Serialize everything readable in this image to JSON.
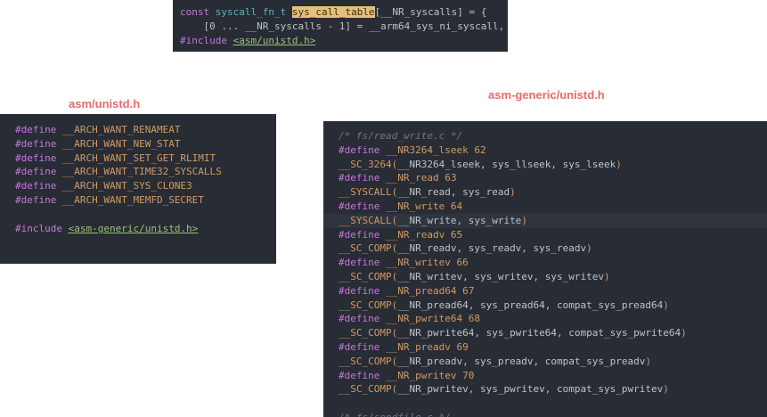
{
  "top_panel": {
    "lines": [
      [
        {
          "c": "kw",
          "t": "const "
        },
        {
          "c": "ty",
          "t": "syscall_fn_t "
        },
        {
          "c": "hl",
          "t": "sys_call_table"
        },
        {
          "c": "id",
          "t": "[__NR_syscalls] = {"
        }
      ],
      [
        {
          "c": "id",
          "t": "    [0 ... __NR_syscalls - 1] = __arm64_sys_ni_syscall,"
        }
      ],
      [
        {
          "c": "kw",
          "t": "#include "
        },
        {
          "c": "str",
          "t": "<asm/unistd.h>"
        }
      ]
    ]
  },
  "left_heading": "asm/unistd.h",
  "left_panel": {
    "lines": [
      [
        {
          "c": "kw",
          "t": "#define "
        },
        {
          "c": "mac",
          "t": "__ARCH_WANT_RENAMEAT"
        }
      ],
      [
        {
          "c": "kw",
          "t": "#define "
        },
        {
          "c": "mac",
          "t": "__ARCH_WANT_NEW_STAT"
        }
      ],
      [
        {
          "c": "kw",
          "t": "#define "
        },
        {
          "c": "mac",
          "t": "__ARCH_WANT_SET_GET_RLIMIT"
        }
      ],
      [
        {
          "c": "kw",
          "t": "#define "
        },
        {
          "c": "mac",
          "t": "__ARCH_WANT_TIME32_SYSCALLS"
        }
      ],
      [
        {
          "c": "kw",
          "t": "#define "
        },
        {
          "c": "mac",
          "t": "__ARCH_WANT_SYS_CLONE3"
        }
      ],
      [
        {
          "c": "kw",
          "t": "#define "
        },
        {
          "c": "mac",
          "t": "__ARCH_WANT_MEMFD_SECRET"
        }
      ],
      [],
      [
        {
          "c": "kw",
          "t": "#include "
        },
        {
          "c": "str",
          "t": "<asm-generic/unistd.h>"
        }
      ]
    ]
  },
  "right_heading": "asm-generic/unistd.h",
  "right_panel": {
    "lines": [
      [
        {
          "c": "cm",
          "t": "/* fs/read_write.c */"
        }
      ],
      [
        {
          "c": "kw",
          "t": "#define "
        },
        {
          "c": "mac",
          "t": "__NR3264_lseek 62"
        }
      ],
      [
        {
          "c": "mac",
          "t": "__SC_3264("
        },
        {
          "c": "id",
          "t": "__NR3264_lseek, sys_llseek, sys_lseek"
        },
        {
          "c": "mac",
          "t": ")"
        }
      ],
      [
        {
          "c": "kw",
          "t": "#define "
        },
        {
          "c": "mac",
          "t": "__NR_read 63"
        }
      ],
      [
        {
          "c": "mac",
          "t": "__SYSCALL("
        },
        {
          "c": "id",
          "t": "__NR_read, sys_read"
        },
        {
          "c": "mac",
          "t": ")"
        }
      ],
      [
        {
          "c": "kw",
          "t": "#define "
        },
        {
          "c": "mac",
          "t": "__NR_write 64"
        }
      ],
      [
        {
          "c": "mac",
          "t": "__SYSCALL("
        },
        {
          "c": "id",
          "t": "__NR_write, sys_write"
        },
        {
          "c": "mac",
          "t": ")"
        }
      ],
      [
        {
          "c": "kw",
          "t": "#define "
        },
        {
          "c": "mac",
          "t": "__NR_readv 65"
        }
      ],
      [
        {
          "c": "mac",
          "t": "__SC_COMP("
        },
        {
          "c": "id",
          "t": "__NR_readv, sys_readv, sys_readv"
        },
        {
          "c": "mac",
          "t": ")"
        }
      ],
      [
        {
          "c": "kw",
          "t": "#define "
        },
        {
          "c": "mac",
          "t": "__NR_writev 66"
        }
      ],
      [
        {
          "c": "mac",
          "t": "__SC_COMP("
        },
        {
          "c": "id",
          "t": "__NR_writev, sys_writev, sys_writev"
        },
        {
          "c": "mac",
          "t": ")"
        }
      ],
      [
        {
          "c": "kw",
          "t": "#define "
        },
        {
          "c": "mac",
          "t": "__NR_pread64 67"
        }
      ],
      [
        {
          "c": "mac",
          "t": "__SC_COMP("
        },
        {
          "c": "id",
          "t": "__NR_pread64, sys_pread64, compat_sys_pread64"
        },
        {
          "c": "mac",
          "t": ")"
        }
      ],
      [
        {
          "c": "kw",
          "t": "#define "
        },
        {
          "c": "mac",
          "t": "__NR_pwrite64 68"
        }
      ],
      [
        {
          "c": "mac",
          "t": "__SC_COMP("
        },
        {
          "c": "id",
          "t": "__NR_pwrite64, sys_pwrite64, compat_sys_pwrite64"
        },
        {
          "c": "mac",
          "t": ")"
        }
      ],
      [
        {
          "c": "kw",
          "t": "#define "
        },
        {
          "c": "mac",
          "t": "__NR_preadv 69"
        }
      ],
      [
        {
          "c": "mac",
          "t": "__SC_COMP("
        },
        {
          "c": "id",
          "t": "__NR_preadv, sys_preadv, compat_sys_preadv"
        },
        {
          "c": "mac",
          "t": ")"
        }
      ],
      [
        {
          "c": "kw",
          "t": "#define "
        },
        {
          "c": "mac",
          "t": "__NR_pwritev 70"
        }
      ],
      [
        {
          "c": "mac",
          "t": "__SC_COMP("
        },
        {
          "c": "id",
          "t": "__NR_pwritev, sys_pwritev, compat_sys_pwritev"
        },
        {
          "c": "mac",
          "t": ")"
        }
      ],
      [],
      [
        {
          "c": "cm",
          "t": "/* fs/sendfile.c */"
        }
      ]
    ]
  }
}
